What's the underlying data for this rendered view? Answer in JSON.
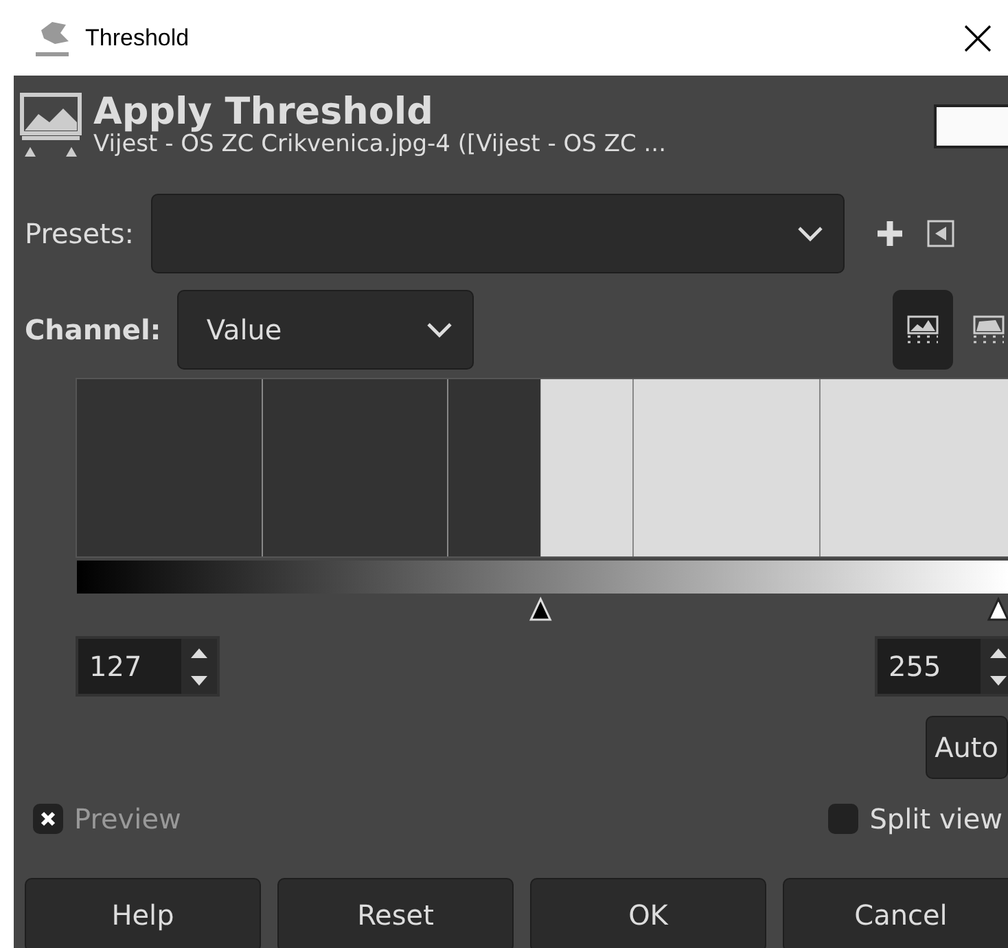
{
  "window": {
    "title": "Threshold"
  },
  "header": {
    "title": "Apply Threshold",
    "subtitle": "Vijest - OS ZC Crikvenica.jpg-4 ([Vijest - OS ZC ..."
  },
  "presets": {
    "label": "Presets:"
  },
  "channel": {
    "label": "Channel:",
    "value": "Value"
  },
  "histogram_scale": [
    {
      "kind": "linear",
      "selected": true
    },
    {
      "kind": "log",
      "selected": false
    }
  ],
  "threshold": {
    "low": {
      "value": "127",
      "level": 0.498
    },
    "high": {
      "value": "255",
      "level": 1.0
    }
  },
  "auto_button": "Auto",
  "options": [
    {
      "label": "Preview",
      "checked": true
    },
    {
      "label": "Split view",
      "checked": false
    }
  ],
  "buttons": [
    "Help",
    "Reset",
    "OK",
    "Cancel"
  ]
}
